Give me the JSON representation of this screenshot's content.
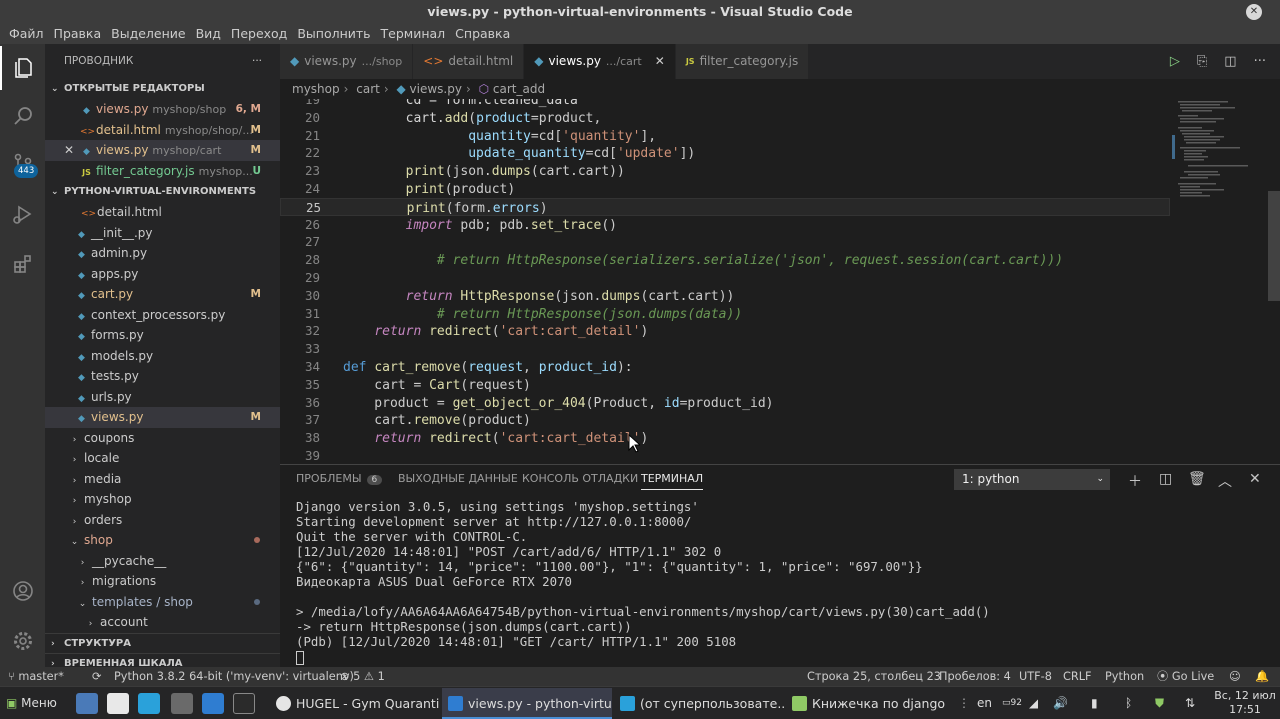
{
  "window_title": "views.py - python-virtual-environments - Visual Studio Code",
  "menu": [
    "Файл",
    "Правка",
    "Выделение",
    "Вид",
    "Переход",
    "Выполнить",
    "Терминал",
    "Справка"
  ],
  "activity": {
    "badge": "443"
  },
  "sidebar": {
    "title": "ПРОВОДНИК",
    "open_editors_title": "ОТКРЫТЫЕ РЕДАКТОРЫ",
    "open_editors": [
      {
        "name": "views.py",
        "path": "myshop/shop",
        "status": "6, M"
      },
      {
        "name": "detail.html",
        "path": "myshop/shop/...",
        "status": "M"
      },
      {
        "name": "views.py",
        "path": "myshop/cart",
        "status": "M"
      },
      {
        "name": "filter_category.js",
        "path": "myshop...",
        "status": "U"
      }
    ],
    "project_title": "PYTHON-VIRTUAL-ENVIRONMENTS",
    "tree": [
      {
        "name": "detail.html",
        "status": ""
      },
      {
        "name": "__init__.py",
        "status": ""
      },
      {
        "name": "admin.py",
        "status": ""
      },
      {
        "name": "apps.py",
        "status": ""
      },
      {
        "name": "cart.py",
        "status": "M"
      },
      {
        "name": "context_processors.py",
        "status": ""
      },
      {
        "name": "forms.py",
        "status": ""
      },
      {
        "name": "models.py",
        "status": ""
      },
      {
        "name": "tests.py",
        "status": ""
      },
      {
        "name": "urls.py",
        "status": ""
      },
      {
        "name": "views.py",
        "status": "M"
      }
    ],
    "folders": [
      "coupons",
      "locale",
      "media",
      "myshop",
      "orders",
      "shop",
      "__pycache__",
      "migrations",
      "templates / shop",
      "account"
    ],
    "outline_title": "СТРУКТУРА",
    "timeline_title": "ВРЕМЕННАЯ ШКАЛА"
  },
  "tabs": [
    {
      "name": "views.py",
      "path": ".../shop"
    },
    {
      "name": "detail.html",
      "path": ""
    },
    {
      "name": "views.py",
      "path": ".../cart"
    },
    {
      "name": "filter_category.js",
      "path": ""
    }
  ],
  "breadcrumb": [
    "myshop",
    "cart",
    "views.py",
    "cart_add"
  ],
  "code_line_numbers": [
    "19",
    "20",
    "21",
    "22",
    "23",
    "24",
    "25",
    "26",
    "27",
    "28",
    "29",
    "30",
    "31",
    "32",
    "33",
    "34",
    "35",
    "36",
    "37",
    "38",
    "39"
  ],
  "panel": {
    "tabs": [
      "ПРОБЛЕМЫ",
      "ВЫХОДНЫЕ ДАННЫЕ",
      "КОНСОЛЬ ОТЛАДКИ",
      "ТЕРМИНАЛ"
    ],
    "problems_count": "6",
    "terminal_select": "1: python",
    "terminal_lines": [
      "Django version 3.0.5, using settings 'myshop.settings'",
      "Starting development server at http://127.0.0.1:8000/",
      "Quit the server with CONTROL-C.",
      "[12/Jul/2020 14:48:01] \"POST /cart/add/6/ HTTP/1.1\" 302 0",
      "{\"6\": {\"quantity\": 14, \"price\": \"1100.00\"}, \"1\": {\"quantity\": 1, \"price\": \"697.00\"}}",
      "Видеокарта ASUS Dual GeForce RTX 2070",
      "",
      "> /media/lofy/AA6A64AA6A64754B/python-virtual-environments/myshop/cart/views.py(30)cart_add()",
      "-> return HttpResponse(json.dumps(cart.cart))",
      "(Pdb) [12/Jul/2020 14:48:01] \"GET /cart/ HTTP/1.1\" 200 5108"
    ]
  },
  "status": {
    "branch": "master*",
    "interpreter": "Python 3.8.2 64-bit ('my-venv': virtualenv)",
    "errors": "5",
    "warnings": "1",
    "position": "Строка 25, столбец 23",
    "spaces": "Пробелов: 4",
    "encoding": "UTF-8",
    "eol": "CRLF",
    "language": "Python",
    "golive": "Go Live"
  },
  "taskbar": {
    "menu": "Меню",
    "windows": [
      "HUGEL - Gym Quaranti...",
      "views.py - python-virtu...",
      "(от суперпользовате...",
      "Книжечка по django"
    ],
    "lang": "en",
    "date": "Вс, 12 июл",
    "time": "17:51",
    "batt": "92"
  }
}
